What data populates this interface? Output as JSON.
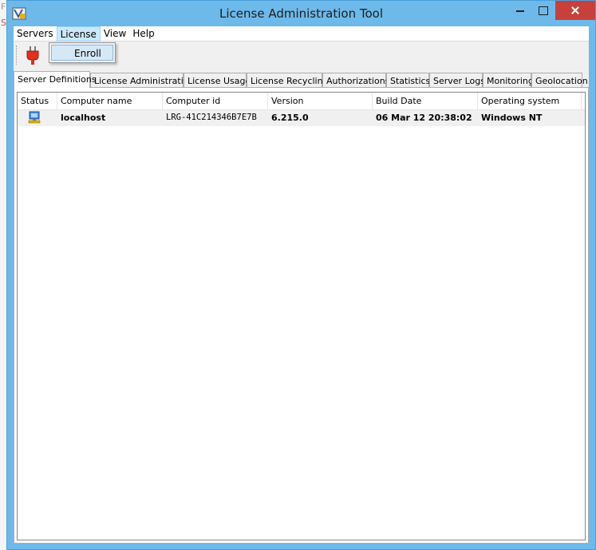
{
  "window": {
    "title": "License Administration Tool"
  },
  "menubar": [
    {
      "label": "Servers"
    },
    {
      "label": "License"
    },
    {
      "label": "View"
    },
    {
      "label": "Help"
    }
  ],
  "dropdown": {
    "items": [
      {
        "label": "Enroll"
      }
    ]
  },
  "toolbar": {
    "icons": [
      "plug-icon",
      "disconnect-icon",
      "refresh-icon",
      "server-icon"
    ]
  },
  "tabs": [
    {
      "label": "Server Definitions"
    },
    {
      "label": "License Administration"
    },
    {
      "label": "License Usage"
    },
    {
      "label": "License Recycling"
    },
    {
      "label": "Authorizations"
    },
    {
      "label": "Statistics"
    },
    {
      "label": "Server Logs"
    },
    {
      "label": "Monitoring"
    },
    {
      "label": "Geolocation"
    }
  ],
  "table": {
    "columns": [
      "Status",
      "Computer name",
      "Computer id",
      "Version",
      "Build Date",
      "Operating system"
    ],
    "rows": [
      {
        "status_icon": "computer-icon",
        "computer_name": "localhost",
        "computer_id": "LRG-41C214346B7E7B",
        "version": "6.215.0",
        "build_date": "06 Mar 12 20:38:02",
        "operating_system": "Windows NT"
      }
    ]
  },
  "colors": {
    "titlebar": "#6cb9ea",
    "close_button": "#c7413a",
    "menu_highlight": "#cce8ff",
    "row_background": "#f0f0f0"
  }
}
